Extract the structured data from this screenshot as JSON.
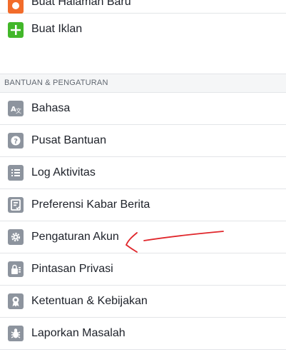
{
  "menu_top": {
    "items": [
      {
        "label": "Buat Halaman Baru",
        "icon": "flag-icon",
        "color": "#f26c2b"
      },
      {
        "label": "Buat Iklan",
        "icon": "plus-icon",
        "color": "#42b72a"
      }
    ]
  },
  "section": {
    "header": "BANTUAN & PENGATURAN",
    "items": [
      {
        "label": "Bahasa",
        "icon": "language-icon"
      },
      {
        "label": "Pusat Bantuan",
        "icon": "help-icon"
      },
      {
        "label": "Log Aktivitas",
        "icon": "list-icon"
      },
      {
        "label": "Preferensi Kabar Berita",
        "icon": "news-feed-icon"
      },
      {
        "label": "Pengaturan Akun",
        "icon": "gear-icon"
      },
      {
        "label": "Pintasan Privasi",
        "icon": "lock-icon"
      },
      {
        "label": "Ketentuan & Kebijakan",
        "icon": "badge-icon"
      },
      {
        "label": "Laporkan Masalah",
        "icon": "bug-icon"
      }
    ]
  },
  "colors": {
    "icon_gray": "#8d949e",
    "annotation_red": "#e0262b"
  }
}
